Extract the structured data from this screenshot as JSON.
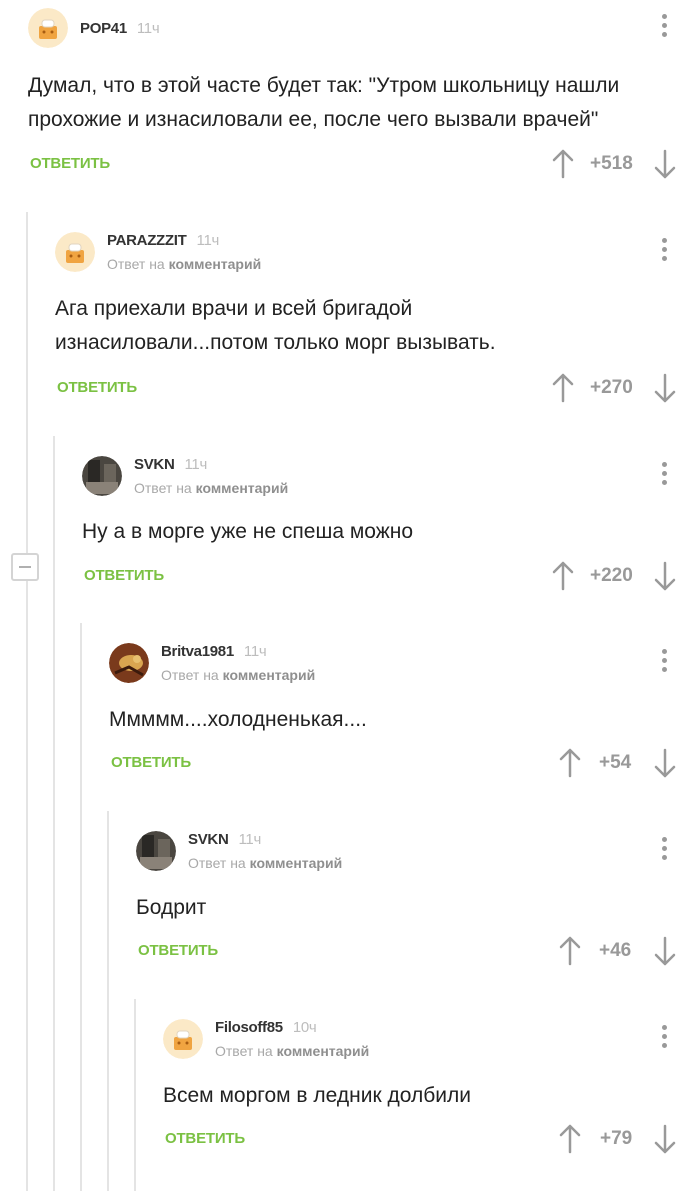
{
  "theme": {
    "accent": "#7bc143",
    "muted": "#999999"
  },
  "comments": [
    {
      "author": "POP41",
      "time": "11ч",
      "reply_to_prefix": "",
      "reply_to_target": "",
      "text_lines": [
        "Думал, что в этой часте будет так: \"Утром школьницу нашли",
        "прохожие и изнасиловали ее, после чего  вызвали врачей\""
      ],
      "reply_label": "ОТВЕТИТЬ",
      "score": "+518",
      "avatar": "pikabu-default-avatar"
    },
    {
      "author": "PARAZZZIT",
      "time": "11ч",
      "reply_to_prefix": "Ответ на",
      "reply_to_target": "комментарий",
      "text_lines": [
        "Ага приехали врачи и всей бригадой",
        "изнасиловали...потом только морг вызывать."
      ],
      "reply_label": "ОТВЕТИТЬ",
      "score": "+270",
      "avatar": "pikabu-default-avatar"
    },
    {
      "author": "SVKN",
      "time": "11ч",
      "reply_to_prefix": "Ответ на",
      "reply_to_target": "комментарий",
      "text_lines": [
        "Ну а в морге уже не спеша можно"
      ],
      "reply_label": "ОТВЕТИТЬ",
      "score": "+220",
      "avatar": "photo-avatar-dark"
    },
    {
      "author": "Britva1981",
      "time": "11ч",
      "reply_to_prefix": "Ответ на",
      "reply_to_target": "комментарий",
      "text_lines": [
        "Ммммм....холодненькая...."
      ],
      "reply_label": "ОТВЕТИТЬ",
      "score": "+54",
      "avatar": "photo-avatar-lizard"
    },
    {
      "author": "SVKN",
      "time": "11ч",
      "reply_to_prefix": "Ответ на",
      "reply_to_target": "комментарий",
      "text_lines": [
        "Бодрит"
      ],
      "reply_label": "ОТВЕТИТЬ",
      "score": "+46",
      "avatar": "photo-avatar-dark"
    },
    {
      "author": "Filosoff85",
      "time": "10ч",
      "reply_to_prefix": "Ответ на",
      "reply_to_target": "комментарий",
      "text_lines": [
        "Всем моргом в ледник долбили"
      ],
      "reply_label": "ОТВЕТИТЬ",
      "score": "+79",
      "avatar": "pikabu-default-avatar"
    }
  ]
}
